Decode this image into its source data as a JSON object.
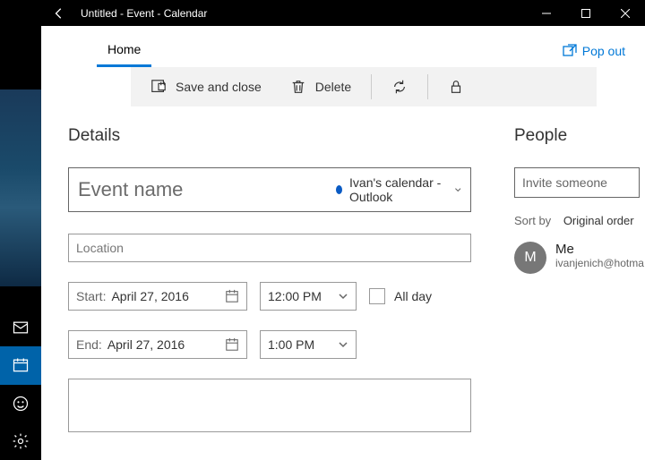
{
  "titlebar": {
    "title": "Untitled - Event - Calendar"
  },
  "tabs": {
    "home": "Home",
    "popout": "Pop out"
  },
  "toolbar": {
    "save_close": "Save and close",
    "delete": "Delete"
  },
  "details": {
    "heading": "Details",
    "event_name_placeholder": "Event name",
    "calendar_name": "Ivan's calendar - Outlook",
    "location_placeholder": "Location",
    "start_label": "Start:",
    "start_date": "April 27, 2016",
    "start_time": "12:00 PM",
    "end_label": "End:",
    "end_date": "April 27, 2016",
    "end_time": "1:00 PM",
    "all_day": "All day"
  },
  "people": {
    "heading": "People",
    "invite_placeholder": "Invite someone",
    "sort_label": "Sort by",
    "sort_value": "Original order",
    "me_initial": "M",
    "me_label": "Me",
    "me_email": "ivanjenich@hotma"
  },
  "colors": {
    "accent": "#0078d7",
    "cal_dot": "#0a5bc4"
  }
}
